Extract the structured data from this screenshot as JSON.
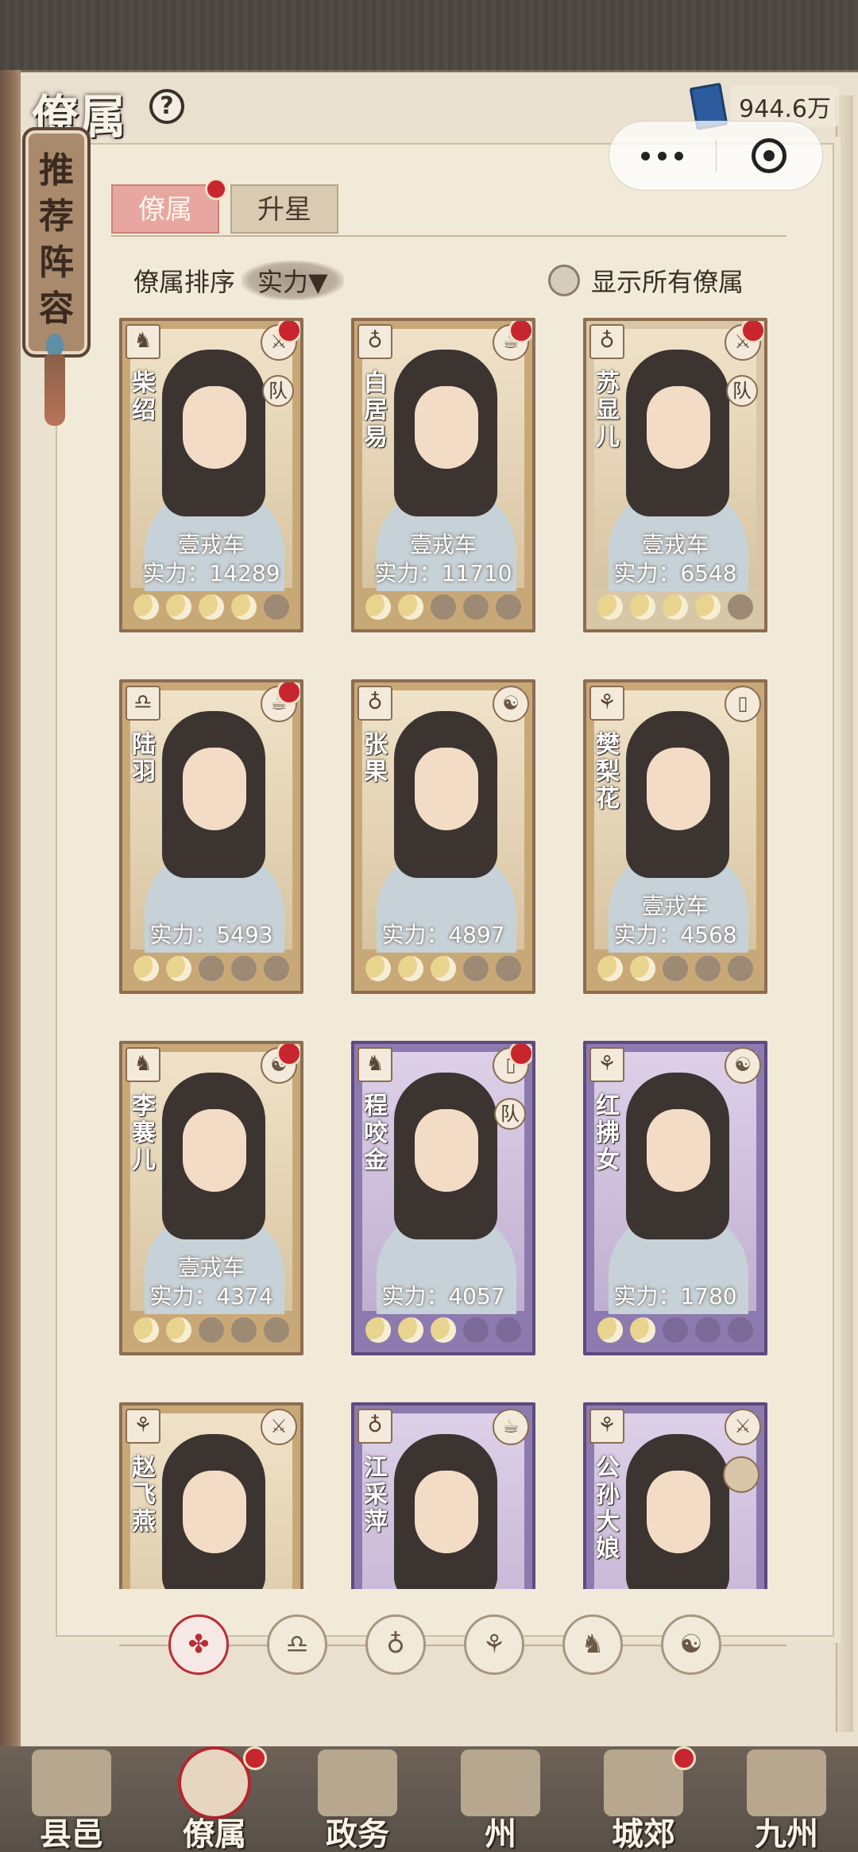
{
  "header": {
    "title": "僚属",
    "currency_value": "944.6万"
  },
  "banner": {
    "text": "推荐阵容"
  },
  "tabs": [
    {
      "label": "僚属",
      "active": true,
      "dot": true
    },
    {
      "label": "升星",
      "active": false,
      "dot": false
    }
  ],
  "sort": {
    "label": "僚属排序",
    "value": "实力▼"
  },
  "show_all": {
    "label": "显示所有僚属"
  },
  "power_prefix": "实力：",
  "cards": [
    {
      "name": "柴绍",
      "title": "壹戎车",
      "power": "14289",
      "stars": 4,
      "rank_icon": "monkey-icon",
      "type_icon": "sword-icon",
      "team": "队",
      "dot": true,
      "variant": "gold"
    },
    {
      "name": "白居易",
      "title": "壹戎车",
      "power": "11710",
      "stars": 2,
      "rank_icon": "gourd-icon",
      "type_icon": "tea-icon",
      "team": "",
      "dot": true,
      "variant": "gold"
    },
    {
      "name": "苏显儿",
      "title": "壹戎车",
      "power": "6548",
      "stars": 4,
      "rank_icon": "gourd-icon",
      "type_icon": "sword-icon",
      "team": "队",
      "dot": true,
      "variant": "light"
    },
    {
      "name": "陆羽",
      "title": "",
      "power": "5493",
      "stars": 2,
      "rank_icon": "bell-icon",
      "type_icon": "tea-icon",
      "team": "",
      "dot": true,
      "variant": "gold"
    },
    {
      "name": "张果",
      "title": "",
      "power": "4897",
      "stars": 3,
      "rank_icon": "gourd-icon",
      "type_icon": "yinyang-icon",
      "team": "",
      "dot": false,
      "variant": "gold"
    },
    {
      "name": "樊梨花",
      "title": "壹戎车",
      "power": "4568",
      "stars": 2,
      "rank_icon": "fan-icon",
      "type_icon": "book-icon",
      "team": "",
      "dot": false,
      "variant": "gold"
    },
    {
      "name": "李褰儿",
      "title": "壹戎车",
      "power": "4374",
      "stars": 2,
      "rank_icon": "monkey-icon",
      "type_icon": "yinyang-icon",
      "team": "",
      "dot": true,
      "variant": "gold"
    },
    {
      "name": "程咬金",
      "title": "",
      "power": "4057",
      "stars": 3,
      "rank_icon": "monkey-icon",
      "type_icon": "book-icon",
      "team": "队",
      "dot": true,
      "variant": "purple"
    },
    {
      "name": "红拂女",
      "title": "",
      "power": "1780",
      "stars": 2,
      "rank_icon": "fan-icon",
      "type_icon": "yinyang-icon",
      "team": "",
      "dot": false,
      "variant": "purple"
    },
    {
      "name": "赵飞燕",
      "title": "",
      "power": "",
      "stars": 0,
      "rank_icon": "fan-icon",
      "type_icon": "sword-icon",
      "team": "",
      "dot": false,
      "variant": "gold"
    },
    {
      "name": "江采萍",
      "title": "",
      "power": "",
      "stars": 0,
      "rank_icon": "gourd-icon",
      "type_icon": "tea-icon",
      "team": "",
      "dot": false,
      "variant": "purple"
    },
    {
      "name": "公孙大娘",
      "title": "",
      "power": "",
      "stars": 0,
      "rank_icon": "fan-icon",
      "type_icon": "sword-icon",
      "team": "",
      "dot": false,
      "variant": "purple",
      "avatar": true
    }
  ],
  "categories": [
    {
      "icon": "diamond-flower-icon",
      "glyph": "✤",
      "active": true
    },
    {
      "icon": "bell-icon",
      "glyph": "♎",
      "active": false
    },
    {
      "icon": "gourd-icon",
      "glyph": "♁",
      "active": false
    },
    {
      "icon": "fan-icon",
      "glyph": "⚘",
      "active": false
    },
    {
      "icon": "monkey-icon",
      "glyph": "♞",
      "active": false
    },
    {
      "icon": "mask-icon",
      "glyph": "☯",
      "active": false
    }
  ],
  "bottom_nav": [
    {
      "label": "县邑",
      "active": false,
      "dot": false
    },
    {
      "label": "僚属",
      "active": true,
      "dot": true
    },
    {
      "label": "政务",
      "active": false,
      "dot": false
    },
    {
      "label": "州",
      "active": false,
      "dot": false
    },
    {
      "label": "城郊",
      "active": false,
      "dot": true
    },
    {
      "label": "九州",
      "active": false,
      "dot": false
    }
  ]
}
